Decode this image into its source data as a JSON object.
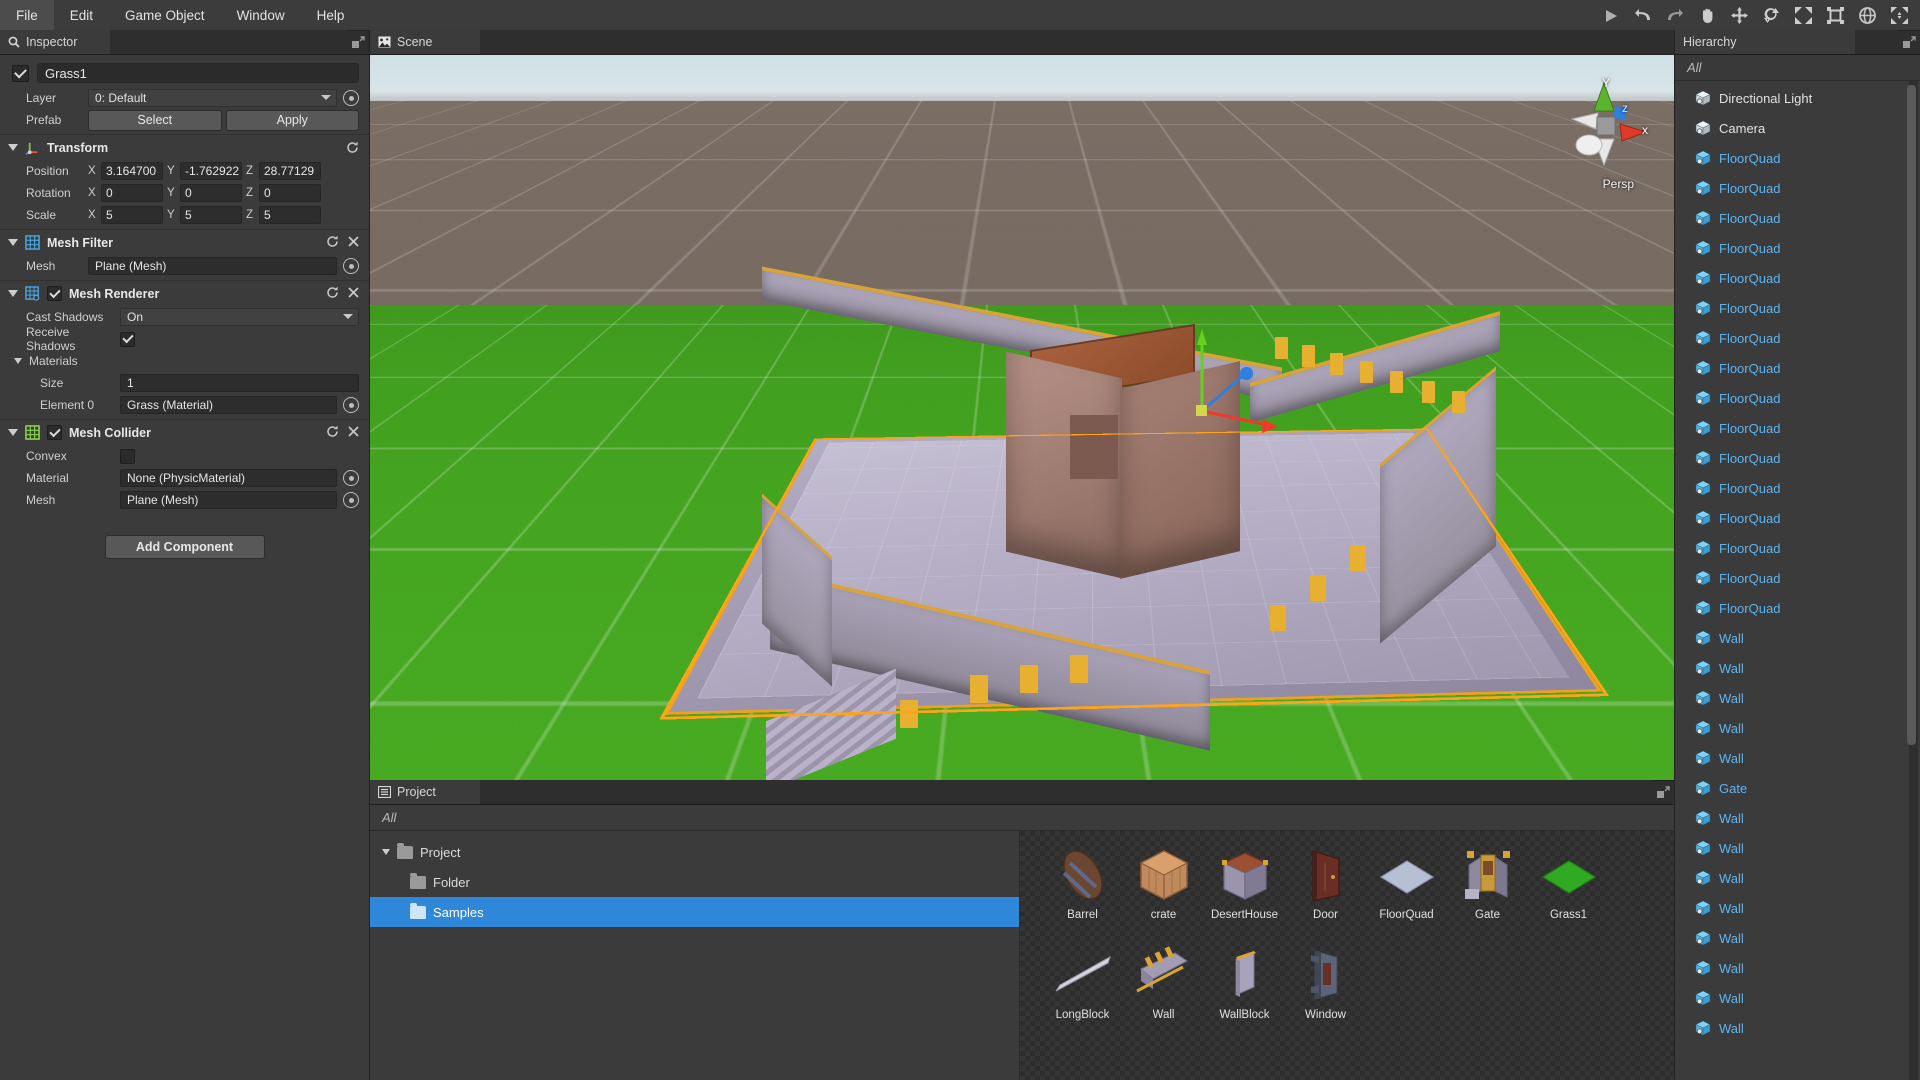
{
  "menubar": {
    "items": [
      "File",
      "Edit",
      "Game Object",
      "Window",
      "Help"
    ],
    "tools": [
      {
        "name": "play-icon",
        "title": "Play"
      },
      {
        "name": "undo-icon",
        "title": "Undo"
      },
      {
        "name": "redo-icon",
        "title": "Redo"
      },
      {
        "name": "hand-tool-icon",
        "title": "Hand"
      },
      {
        "name": "move-tool-icon",
        "title": "Move"
      },
      {
        "name": "rotate-tool-icon",
        "title": "Rotate"
      },
      {
        "name": "scale-tool-icon",
        "title": "Scale"
      },
      {
        "name": "rect-tool-icon",
        "title": "Rect"
      },
      {
        "name": "global-local-icon",
        "title": "Global"
      },
      {
        "name": "expand-icon",
        "title": "Maximize"
      }
    ]
  },
  "inspector": {
    "tab_label": "Inspector",
    "object_name": "Grass1",
    "object_enabled": true,
    "layer_label": "Layer",
    "layer_value": "0: Default",
    "prefab_label": "Prefab",
    "prefab_select": "Select",
    "prefab_apply": "Apply",
    "add_component": "Add Component",
    "transform": {
      "title": "Transform",
      "rows": [
        {
          "label": "Position",
          "x": "3.164700",
          "y": "-1.762922",
          "z": "28.77129"
        },
        {
          "label": "Rotation",
          "x": "0",
          "y": "0",
          "z": "0"
        },
        {
          "label": "Scale",
          "x": "5",
          "y": "5",
          "z": "5"
        }
      ],
      "axes": [
        "X",
        "Y",
        "Z"
      ]
    },
    "mesh_filter": {
      "title": "Mesh Filter",
      "mesh_label": "Mesh",
      "mesh_value": "Plane (Mesh)"
    },
    "mesh_renderer": {
      "title": "Mesh Renderer",
      "enabled": true,
      "cast_shadows_label": "Cast Shadows",
      "cast_shadows_value": "On",
      "receive_shadows_label": "Receive Shadows",
      "receive_shadows_value": true,
      "materials_label": "Materials",
      "size_label": "Size",
      "size_value": "1",
      "element0_label": "Element 0",
      "element0_value": "Grass (Material)"
    },
    "mesh_collider": {
      "title": "Mesh Collider",
      "enabled": true,
      "convex_label": "Convex",
      "convex_value": false,
      "material_label": "Material",
      "material_value": "None (PhysicMaterial)",
      "mesh_label": "Mesh",
      "mesh_value": "Plane (Mesh)"
    }
  },
  "scene": {
    "tab_label": "Scene",
    "view_gizmo": {
      "x_label": "x",
      "y_label": "Y",
      "z_label": "z",
      "projection": "Persp"
    }
  },
  "project": {
    "tab_label": "Project",
    "filter_label": "All",
    "tree": [
      {
        "label": "Project",
        "indent": 0,
        "expanded": true,
        "selected": false
      },
      {
        "label": "Folder",
        "indent": 1,
        "expanded": false,
        "selected": false
      },
      {
        "label": "Samples",
        "indent": 1,
        "expanded": false,
        "selected": true
      }
    ],
    "assets": [
      {
        "name": "Barrel",
        "icon": "barrel-thumb"
      },
      {
        "name": "crate",
        "icon": "crate-thumb"
      },
      {
        "name": "DesertHouse",
        "icon": "deserthouse-thumb"
      },
      {
        "name": "Door",
        "icon": "door-thumb"
      },
      {
        "name": "FloorQuad",
        "icon": "floorquad-thumb"
      },
      {
        "name": "Gate",
        "icon": "gate-thumb"
      },
      {
        "name": "Grass1",
        "icon": "grass-thumb"
      },
      {
        "name": "LongBlock",
        "icon": "longblock-thumb"
      },
      {
        "name": "Wall",
        "icon": "wall-thumb"
      },
      {
        "name": "WallBlock",
        "icon": "wallblock-thumb"
      },
      {
        "name": "Window",
        "icon": "window-thumb"
      }
    ]
  },
  "hierarchy": {
    "tab_label": "Hierarchy",
    "filter_label": "All",
    "items": [
      {
        "label": "Directional Light",
        "kind": "light"
      },
      {
        "label": "Camera",
        "kind": "camera"
      },
      {
        "label": "FloorQuad",
        "kind": "prefab"
      },
      {
        "label": "FloorQuad",
        "kind": "prefab"
      },
      {
        "label": "FloorQuad",
        "kind": "prefab"
      },
      {
        "label": "FloorQuad",
        "kind": "prefab"
      },
      {
        "label": "FloorQuad",
        "kind": "prefab"
      },
      {
        "label": "FloorQuad",
        "kind": "prefab"
      },
      {
        "label": "FloorQuad",
        "kind": "prefab"
      },
      {
        "label": "FloorQuad",
        "kind": "prefab"
      },
      {
        "label": "FloorQuad",
        "kind": "prefab"
      },
      {
        "label": "FloorQuad",
        "kind": "prefab"
      },
      {
        "label": "FloorQuad",
        "kind": "prefab"
      },
      {
        "label": "FloorQuad",
        "kind": "prefab"
      },
      {
        "label": "FloorQuad",
        "kind": "prefab"
      },
      {
        "label": "FloorQuad",
        "kind": "prefab"
      },
      {
        "label": "FloorQuad",
        "kind": "prefab"
      },
      {
        "label": "FloorQuad",
        "kind": "prefab"
      },
      {
        "label": "Wall",
        "kind": "prefab"
      },
      {
        "label": "Wall",
        "kind": "prefab"
      },
      {
        "label": "Wall",
        "kind": "prefab"
      },
      {
        "label": "Wall",
        "kind": "prefab"
      },
      {
        "label": "Wall",
        "kind": "prefab"
      },
      {
        "label": "Gate",
        "kind": "prefab"
      },
      {
        "label": "Wall",
        "kind": "prefab"
      },
      {
        "label": "Wall",
        "kind": "prefab"
      },
      {
        "label": "Wall",
        "kind": "prefab"
      },
      {
        "label": "Wall",
        "kind": "prefab"
      },
      {
        "label": "Wall",
        "kind": "prefab"
      },
      {
        "label": "Wall",
        "kind": "prefab"
      },
      {
        "label": "Wall",
        "kind": "prefab"
      },
      {
        "label": "Wall",
        "kind": "prefab"
      }
    ]
  },
  "colors": {
    "accent_selection": "#2e87d8",
    "hierarchy_prefab_text": "#5fb4f0",
    "selection_outline": "#ffa319",
    "panel_bg": "#3b3b3b",
    "menu_bg": "#3c3c3c",
    "grass_green": "#43a01f"
  }
}
